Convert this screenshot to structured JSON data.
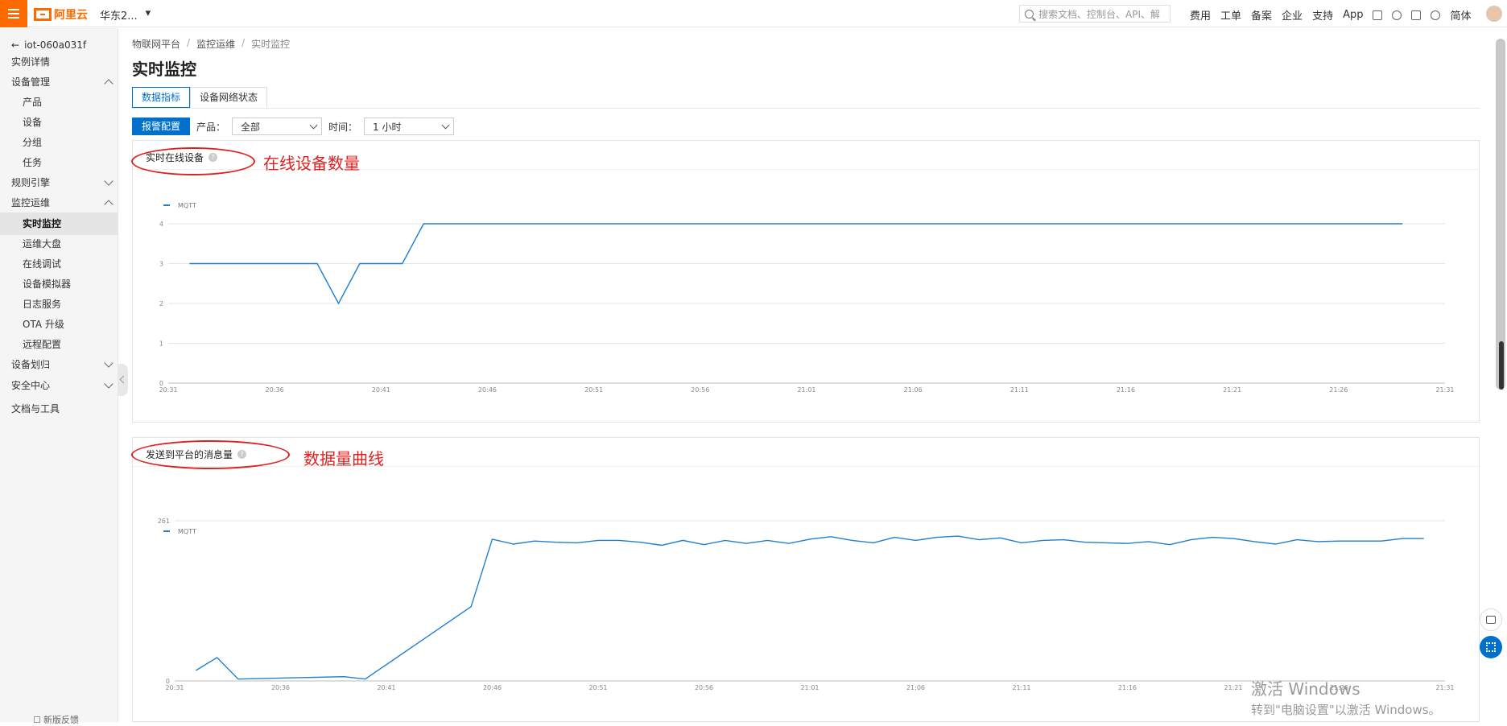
{
  "topbar": {
    "logo_text": "阿里云",
    "region": "华东2...",
    "search_placeholder": "搜索文档、控制台、API、解",
    "links": [
      "费用",
      "工单",
      "备案",
      "企业",
      "支持",
      "App"
    ],
    "lang": "简体"
  },
  "sidebar": {
    "back_label": "iot-060a031f",
    "items": [
      {
        "label": "实例详情",
        "level": 0
      },
      {
        "label": "设备管理",
        "level": 0,
        "chevron": "up"
      },
      {
        "label": "产品",
        "level": 1
      },
      {
        "label": "设备",
        "level": 1
      },
      {
        "label": "分组",
        "level": 1
      },
      {
        "label": "任务",
        "level": 1
      },
      {
        "label": "规则引擎",
        "level": 0,
        "chevron": "down"
      },
      {
        "label": "监控运维",
        "level": 0,
        "chevron": "up"
      },
      {
        "label": "实时监控",
        "level": 1,
        "active": true
      },
      {
        "label": "运维大盘",
        "level": 1
      },
      {
        "label": "在线调试",
        "level": 1
      },
      {
        "label": "设备模拟器",
        "level": 1
      },
      {
        "label": "日志服务",
        "level": 1
      },
      {
        "label": "OTA 升级",
        "level": 1
      },
      {
        "label": "远程配置",
        "level": 1
      },
      {
        "label": "设备划归",
        "level": 0,
        "chevron": "down"
      },
      {
        "label": "安全中心",
        "level": 0,
        "chevron": "down"
      },
      {
        "label": "文档与工具",
        "level": 0
      }
    ],
    "feedback": "新版反馈"
  },
  "breadcrumb": [
    "物联网平台",
    "监控运维",
    "实时监控"
  ],
  "page_title": "实时监控",
  "tabs": [
    {
      "label": "数据指标",
      "active": true
    },
    {
      "label": "设备网络状态",
      "active": false
    }
  ],
  "filters": {
    "alarm_button": "报警配置",
    "product_label": "产品：",
    "product_value": "全部",
    "time_label": "时间：",
    "time_value": "1 小时"
  },
  "annotations": {
    "online_note": "在线设备数量",
    "messages_note": "数据量曲线"
  },
  "colors": {
    "accent": "#0070cc",
    "brand": "#ff6a00",
    "annotation": "#e02020",
    "line": "#1f7fd0"
  },
  "chart_data": [
    {
      "type": "line",
      "title": "实时在线设备",
      "series": [
        {
          "name": "MQTT",
          "points": [
            [
              "20:32",
              3
            ],
            [
              "20:34",
              3
            ],
            [
              "20:36",
              3
            ],
            [
              "20:38",
              3
            ],
            [
              "20:39",
              2
            ],
            [
              "20:40",
              3
            ],
            [
              "20:42",
              3
            ],
            [
              "20:43",
              4
            ],
            [
              "20:46",
              4
            ],
            [
              "21:00",
              4
            ],
            [
              "21:15",
              4
            ],
            [
              "21:29",
              4
            ]
          ]
        }
      ],
      "x_ticks": [
        "20:31",
        "20:36",
        "20:41",
        "20:46",
        "20:51",
        "20:56",
        "21:01",
        "21:06",
        "21:11",
        "21:16",
        "21:21",
        "21:26",
        "21:31"
      ],
      "y_ticks": [
        0,
        1,
        2,
        3,
        4
      ],
      "ylim": [
        0,
        4
      ],
      "legend": "top-left",
      "grid": true
    },
    {
      "type": "line",
      "title": "发送到平台的消息量",
      "series": [
        {
          "name": "MQTT",
          "points": [
            [
              "20:32",
              17
            ],
            [
              "20:33",
              38
            ],
            [
              "20:34",
              3
            ],
            [
              "20:39",
              7
            ],
            [
              "20:40",
              3
            ],
            [
              "20:45",
              121
            ],
            [
              "20:46",
              231
            ],
            [
              "20:47",
              223
            ],
            [
              "20:48",
              228
            ],
            [
              "20:49",
              226
            ],
            [
              "20:50",
              225
            ],
            [
              "20:51",
              229
            ],
            [
              "20:52",
              229
            ],
            [
              "20:53",
              226
            ],
            [
              "20:54",
              221
            ],
            [
              "20:55",
              229
            ],
            [
              "20:56",
              222
            ],
            [
              "20:57",
              229
            ],
            [
              "20:58",
              224
            ],
            [
              "20:59",
              229
            ],
            [
              "21:00",
              224
            ],
            [
              "21:01",
              231
            ],
            [
              "21:02",
              235
            ],
            [
              "21:03",
              229
            ],
            [
              "21:04",
              225
            ],
            [
              "21:05",
              234
            ],
            [
              "21:06",
              229
            ],
            [
              "21:07",
              234
            ],
            [
              "21:08",
              236
            ],
            [
              "21:09",
              230
            ],
            [
              "21:10",
              233
            ],
            [
              "21:11",
              225
            ],
            [
              "21:12",
              229
            ],
            [
              "21:13",
              230
            ],
            [
              "21:14",
              226
            ],
            [
              "21:15",
              225
            ],
            [
              "21:16",
              224
            ],
            [
              "21:17",
              227
            ],
            [
              "21:18",
              222
            ],
            [
              "21:19",
              230
            ],
            [
              "21:20",
              234
            ],
            [
              "21:21",
              232
            ],
            [
              "21:22",
              227
            ],
            [
              "21:23",
              223
            ],
            [
              "21:24",
              230
            ],
            [
              "21:25",
              227
            ],
            [
              "21:26",
              228
            ],
            [
              "21:27",
              228
            ],
            [
              "21:28",
              228
            ],
            [
              "21:29",
              232
            ],
            [
              "21:30",
              232
            ]
          ]
        }
      ],
      "x_ticks": [
        "20:31",
        "20:36",
        "20:41",
        "20:46",
        "20:51",
        "20:56",
        "21:01",
        "21:06",
        "21:11",
        "21:16",
        "21:21",
        "21:26",
        "21:31"
      ],
      "y_ticks": [
        0,
        261
      ],
      "ylim": [
        0,
        261
      ],
      "legend": "top-left",
      "grid": true
    }
  ],
  "watermark": {
    "line1": "激活 Windows",
    "line2": "转到\"电脑设置\"以激活 Windows。"
  }
}
